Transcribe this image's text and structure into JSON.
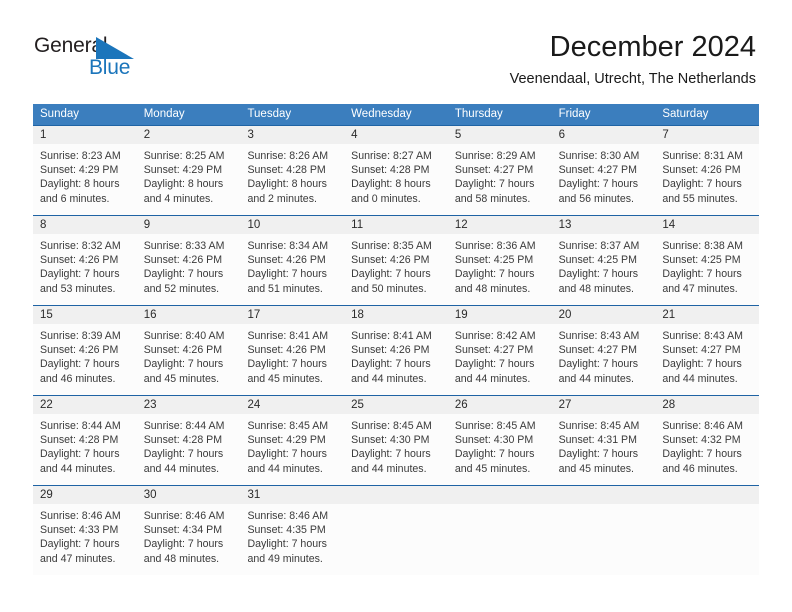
{
  "brand": {
    "word_general": "General",
    "word_blue": "Blue",
    "mark_name": "triangle-logo-mark",
    "accent_color": "#1b75bb"
  },
  "header": {
    "title": "December 2024",
    "subtitle": "Veenendaal, Utrecht, The Netherlands"
  },
  "colors": {
    "header_blue": "#3b7ebe",
    "separator_blue": "#1f63a4",
    "daynum_band": "#f0f0f0",
    "cell_background": "#fcfcfc",
    "text": "#3a3a3a"
  },
  "weekdays": [
    "Sunday",
    "Monday",
    "Tuesday",
    "Wednesday",
    "Thursday",
    "Friday",
    "Saturday"
  ],
  "weeks": [
    {
      "days": [
        {
          "num": "1",
          "sunrise": "Sunrise: 8:23 AM",
          "sunset": "Sunset: 4:29 PM",
          "daylight1": "Daylight: 8 hours",
          "daylight2": "and 6 minutes."
        },
        {
          "num": "2",
          "sunrise": "Sunrise: 8:25 AM",
          "sunset": "Sunset: 4:29 PM",
          "daylight1": "Daylight: 8 hours",
          "daylight2": "and 4 minutes."
        },
        {
          "num": "3",
          "sunrise": "Sunrise: 8:26 AM",
          "sunset": "Sunset: 4:28 PM",
          "daylight1": "Daylight: 8 hours",
          "daylight2": "and 2 minutes."
        },
        {
          "num": "4",
          "sunrise": "Sunrise: 8:27 AM",
          "sunset": "Sunset: 4:28 PM",
          "daylight1": "Daylight: 8 hours",
          "daylight2": "and 0 minutes."
        },
        {
          "num": "5",
          "sunrise": "Sunrise: 8:29 AM",
          "sunset": "Sunset: 4:27 PM",
          "daylight1": "Daylight: 7 hours",
          "daylight2": "and 58 minutes."
        },
        {
          "num": "6",
          "sunrise": "Sunrise: 8:30 AM",
          "sunset": "Sunset: 4:27 PM",
          "daylight1": "Daylight: 7 hours",
          "daylight2": "and 56 minutes."
        },
        {
          "num": "7",
          "sunrise": "Sunrise: 8:31 AM",
          "sunset": "Sunset: 4:26 PM",
          "daylight1": "Daylight: 7 hours",
          "daylight2": "and 55 minutes."
        }
      ]
    },
    {
      "days": [
        {
          "num": "8",
          "sunrise": "Sunrise: 8:32 AM",
          "sunset": "Sunset: 4:26 PM",
          "daylight1": "Daylight: 7 hours",
          "daylight2": "and 53 minutes."
        },
        {
          "num": "9",
          "sunrise": "Sunrise: 8:33 AM",
          "sunset": "Sunset: 4:26 PM",
          "daylight1": "Daylight: 7 hours",
          "daylight2": "and 52 minutes."
        },
        {
          "num": "10",
          "sunrise": "Sunrise: 8:34 AM",
          "sunset": "Sunset: 4:26 PM",
          "daylight1": "Daylight: 7 hours",
          "daylight2": "and 51 minutes."
        },
        {
          "num": "11",
          "sunrise": "Sunrise: 8:35 AM",
          "sunset": "Sunset: 4:26 PM",
          "daylight1": "Daylight: 7 hours",
          "daylight2": "and 50 minutes."
        },
        {
          "num": "12",
          "sunrise": "Sunrise: 8:36 AM",
          "sunset": "Sunset: 4:25 PM",
          "daylight1": "Daylight: 7 hours",
          "daylight2": "and 48 minutes."
        },
        {
          "num": "13",
          "sunrise": "Sunrise: 8:37 AM",
          "sunset": "Sunset: 4:25 PM",
          "daylight1": "Daylight: 7 hours",
          "daylight2": "and 48 minutes."
        },
        {
          "num": "14",
          "sunrise": "Sunrise: 8:38 AM",
          "sunset": "Sunset: 4:25 PM",
          "daylight1": "Daylight: 7 hours",
          "daylight2": "and 47 minutes."
        }
      ]
    },
    {
      "days": [
        {
          "num": "15",
          "sunrise": "Sunrise: 8:39 AM",
          "sunset": "Sunset: 4:26 PM",
          "daylight1": "Daylight: 7 hours",
          "daylight2": "and 46 minutes."
        },
        {
          "num": "16",
          "sunrise": "Sunrise: 8:40 AM",
          "sunset": "Sunset: 4:26 PM",
          "daylight1": "Daylight: 7 hours",
          "daylight2": "and 45 minutes."
        },
        {
          "num": "17",
          "sunrise": "Sunrise: 8:41 AM",
          "sunset": "Sunset: 4:26 PM",
          "daylight1": "Daylight: 7 hours",
          "daylight2": "and 45 minutes."
        },
        {
          "num": "18",
          "sunrise": "Sunrise: 8:41 AM",
          "sunset": "Sunset: 4:26 PM",
          "daylight1": "Daylight: 7 hours",
          "daylight2": "and 44 minutes."
        },
        {
          "num": "19",
          "sunrise": "Sunrise: 8:42 AM",
          "sunset": "Sunset: 4:27 PM",
          "daylight1": "Daylight: 7 hours",
          "daylight2": "and 44 minutes."
        },
        {
          "num": "20",
          "sunrise": "Sunrise: 8:43 AM",
          "sunset": "Sunset: 4:27 PM",
          "daylight1": "Daylight: 7 hours",
          "daylight2": "and 44 minutes."
        },
        {
          "num": "21",
          "sunrise": "Sunrise: 8:43 AM",
          "sunset": "Sunset: 4:27 PM",
          "daylight1": "Daylight: 7 hours",
          "daylight2": "and 44 minutes."
        }
      ]
    },
    {
      "days": [
        {
          "num": "22",
          "sunrise": "Sunrise: 8:44 AM",
          "sunset": "Sunset: 4:28 PM",
          "daylight1": "Daylight: 7 hours",
          "daylight2": "and 44 minutes."
        },
        {
          "num": "23",
          "sunrise": "Sunrise: 8:44 AM",
          "sunset": "Sunset: 4:28 PM",
          "daylight1": "Daylight: 7 hours",
          "daylight2": "and 44 minutes."
        },
        {
          "num": "24",
          "sunrise": "Sunrise: 8:45 AM",
          "sunset": "Sunset: 4:29 PM",
          "daylight1": "Daylight: 7 hours",
          "daylight2": "and 44 minutes."
        },
        {
          "num": "25",
          "sunrise": "Sunrise: 8:45 AM",
          "sunset": "Sunset: 4:30 PM",
          "daylight1": "Daylight: 7 hours",
          "daylight2": "and 44 minutes."
        },
        {
          "num": "26",
          "sunrise": "Sunrise: 8:45 AM",
          "sunset": "Sunset: 4:30 PM",
          "daylight1": "Daylight: 7 hours",
          "daylight2": "and 45 minutes."
        },
        {
          "num": "27",
          "sunrise": "Sunrise: 8:45 AM",
          "sunset": "Sunset: 4:31 PM",
          "daylight1": "Daylight: 7 hours",
          "daylight2": "and 45 minutes."
        },
        {
          "num": "28",
          "sunrise": "Sunrise: 8:46 AM",
          "sunset": "Sunset: 4:32 PM",
          "daylight1": "Daylight: 7 hours",
          "daylight2": "and 46 minutes."
        }
      ]
    },
    {
      "days": [
        {
          "num": "29",
          "sunrise": "Sunrise: 8:46 AM",
          "sunset": "Sunset: 4:33 PM",
          "daylight1": "Daylight: 7 hours",
          "daylight2": "and 47 minutes."
        },
        {
          "num": "30",
          "sunrise": "Sunrise: 8:46 AM",
          "sunset": "Sunset: 4:34 PM",
          "daylight1": "Daylight: 7 hours",
          "daylight2": "and 48 minutes."
        },
        {
          "num": "31",
          "sunrise": "Sunrise: 8:46 AM",
          "sunset": "Sunset: 4:35 PM",
          "daylight1": "Daylight: 7 hours",
          "daylight2": "and 49 minutes."
        },
        {
          "num": "",
          "sunrise": "",
          "sunset": "",
          "daylight1": "",
          "daylight2": ""
        },
        {
          "num": "",
          "sunrise": "",
          "sunset": "",
          "daylight1": "",
          "daylight2": ""
        },
        {
          "num": "",
          "sunrise": "",
          "sunset": "",
          "daylight1": "",
          "daylight2": ""
        },
        {
          "num": "",
          "sunrise": "",
          "sunset": "",
          "daylight1": "",
          "daylight2": ""
        }
      ]
    }
  ]
}
